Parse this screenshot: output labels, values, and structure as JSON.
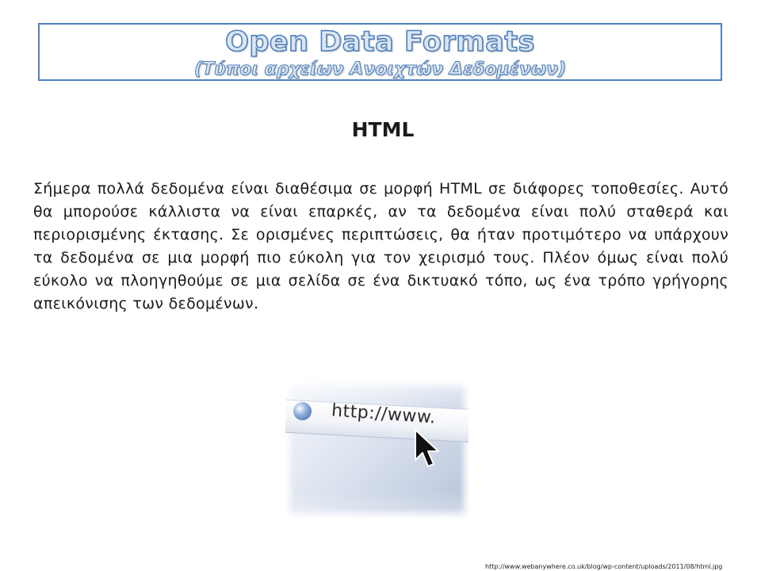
{
  "slide": {
    "title_line1": "Open Data Formats",
    "title_line2": "(Τύποι αρχείων Ανοιχτών Δεδομένων)",
    "heading": "HTML",
    "body": "Σήμερα πολλά δεδομένα είναι διαθέσιμα σε μορφή HTML σε διάφορες τοποθεσίες. Αυτό θα μπορούσε κάλλιστα να είναι επαρκές, αν τα δεδομένα είναι πολύ σταθερά και περιορισμένης έκτασης. Σε ορισμένες περιπτώσεις, θα ήταν προτιμότερο να υπάρχουν τα δεδομένα σε μια μορφή πιο εύκολη για τον χειρισμό τους. Πλέον όμως είναι πολύ εύκολο να πλοηγηθούμε σε μια σελίδα σε ένα δικτυακό τόπο, ως ένα τρόπο γρήγορης  απεικόνισης των δεδομένων.",
    "image": {
      "url_text": "http://www.",
      "icon": "globe-icon",
      "cursor_icon": "arrow-cursor-icon"
    },
    "source_url": "http://www.webanywhere.co.uk/blog/wp-content/uploads/2011/08/html.jpg"
  },
  "colors": {
    "title_border": "#4f81bd",
    "title_fill": "#dbe5f1",
    "text": "#1a1a1a"
  }
}
